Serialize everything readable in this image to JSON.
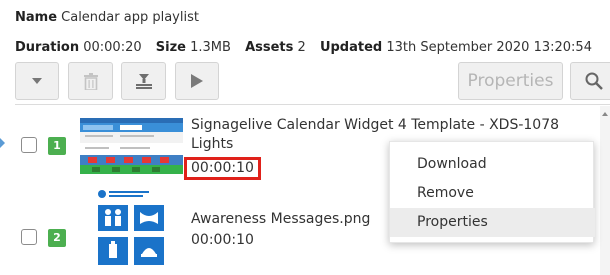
{
  "header": {
    "name_label": "Name",
    "name_value": "Calendar app playlist",
    "duration_label": "Duration",
    "duration_value": "00:00:20",
    "size_label": "Size",
    "size_value": "1.3MB",
    "assets_label": "Assets",
    "assets_value": "2",
    "updated_label": "Updated",
    "updated_value": "13th September 2020 13:20:54"
  },
  "toolbar": {
    "properties_label": "Properties",
    "icons": [
      "chevron-down-icon",
      "trash-icon",
      "download-icon",
      "play-icon",
      "search-icon"
    ]
  },
  "assets": [
    {
      "index": "1",
      "title": "Signagelive Calendar Widget 4 Template - XDS-1078 Lights",
      "duration": "00:00:10",
      "duration_highlighted": true
    },
    {
      "index": "2",
      "title": "Awareness Messages.png",
      "duration": "00:00:10"
    }
  ],
  "context_menu": {
    "items": [
      "Download",
      "Remove",
      "Properties"
    ],
    "hovered": "Properties"
  },
  "colors": {
    "badge": "#4caf50",
    "highlight_border": "#e0211a",
    "row_marker": "#5b9bd5",
    "thumb_blue": "#1a73c9"
  }
}
